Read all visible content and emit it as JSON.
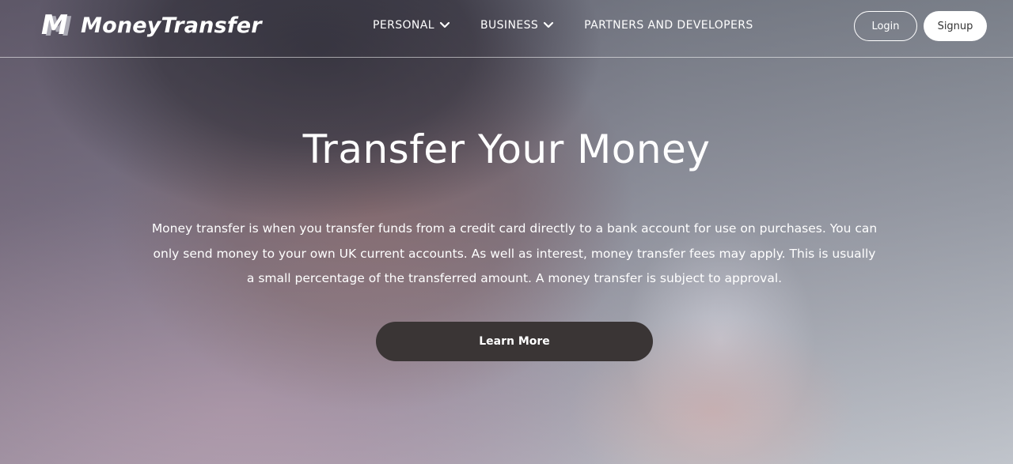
{
  "brand": {
    "logo_mark": "M",
    "name": "MoneyTransfer"
  },
  "nav": {
    "items": [
      {
        "label": "PERSONAL",
        "icon": "chevron-down-icon"
      },
      {
        "label": "BUSINESS",
        "icon": "chevron-down-icon"
      },
      {
        "label": "PARTNERS AND DEVELOPERS"
      }
    ],
    "login_label": "Login",
    "signup_label": "Signup"
  },
  "hero": {
    "title": "Transfer Your Money",
    "description": "Money transfer is when you transfer funds from a credit card directly to a bank account for use on purchases. You can only send money to your own UK current accounts. As well as interest, money transfer fees may apply. This is usually a small percentage of the transferred amount. A money transfer is subject to approval.",
    "cta_label": "Learn More"
  },
  "colors": {
    "cta_background": "#3a3535",
    "text": "#ffffff",
    "signup_background": "#ffffff"
  }
}
